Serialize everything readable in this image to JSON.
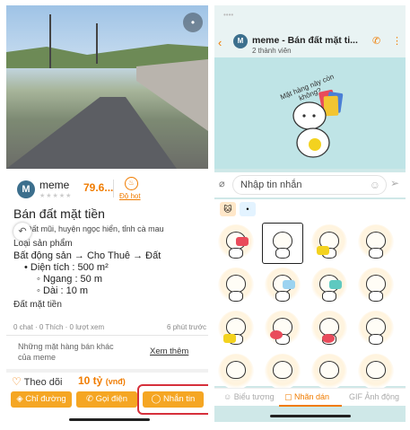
{
  "listing": {
    "seller_name": "meme",
    "seller_initial": "M",
    "score": "79.6...",
    "hot_label": "Độ hot",
    "title": "Bán đất mặt tiền",
    "address": "Đất mũi, huyện ngọc hiển, tỉnh cà mau",
    "category_label": "Loại sản phẩm",
    "category_path": "Bất động sản → Cho Thuê → Đất",
    "area": "Diện tích : 500 m²",
    "width": "Ngang : 50 m",
    "length": "Dài : 10 m",
    "subtitle": "Đất mặt tiền",
    "stats": "0 chat · 0 Thích · 0 lượt xem",
    "posted": "6 phút trước",
    "more_items": "Những mặt hàng bán khác của meme",
    "see_more": "Xem thêm",
    "follow": "Theo dõi",
    "price": "10 tỷ",
    "price_unit": "(vnđ)",
    "btn_directions": "Chỉ đường",
    "btn_call": "Gọi điện",
    "btn_message": "Nhắn tin"
  },
  "chat": {
    "title": "meme - Bán đất mặt ti...",
    "members": "2 thành viên",
    "avatar_initial": "M",
    "banner_text": "Mặt hàng này còn không?",
    "input_placeholder": "Nhập tin nhắn",
    "tab_icons": "Biểu tượng",
    "tab_stickers": "Nhãn dán",
    "tab_gif": "Ảnh động"
  },
  "colors": {
    "accent": "#f07c00",
    "button": "#f5a623",
    "highlight": "#d6303b"
  }
}
